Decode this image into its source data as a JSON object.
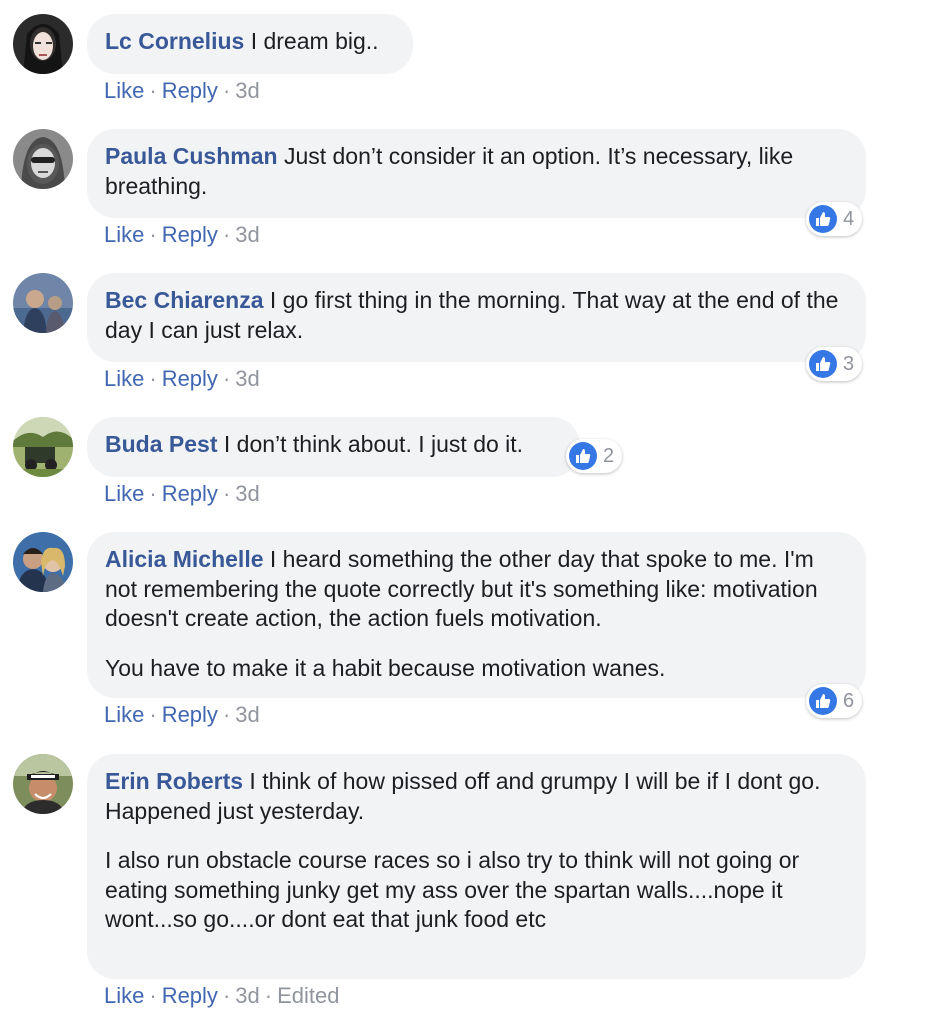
{
  "comments": [
    {
      "author": "Lc Cornelius",
      "paragraphs": [
        "I dream big.."
      ],
      "like": "Like",
      "reply": "Reply",
      "time": "3d",
      "edited": "",
      "reactions": ""
    },
    {
      "author": "Paula Cushman",
      "paragraphs": [
        "Just don’t consider it an option. It’s necessary, like breathing."
      ],
      "like": "Like",
      "reply": "Reply",
      "time": "3d",
      "edited": "",
      "reactions": "4"
    },
    {
      "author": "Bec Chiarenza",
      "paragraphs": [
        "I go first thing in the morning. That way at the end of the day I can just relax."
      ],
      "like": "Like",
      "reply": "Reply",
      "time": "3d",
      "edited": "",
      "reactions": "3"
    },
    {
      "author": "Buda Pest",
      "paragraphs": [
        "I don’t think about. I just do it."
      ],
      "like": "Like",
      "reply": "Reply",
      "time": "3d",
      "edited": "",
      "reactions": "2"
    },
    {
      "author": "Alicia Michelle",
      "paragraphs": [
        "I heard something the other day that spoke to me. I'm not remembering the quote correctly but it's something like: motivation doesn't create action, the action fuels motivation.",
        "You have to make it a habit because motivation wanes."
      ],
      "like": "Like",
      "reply": "Reply",
      "time": "3d",
      "edited": "",
      "reactions": "6"
    },
    {
      "author": "Erin Roberts",
      "paragraphs": [
        "I think of how pissed off and grumpy I will be if I dont go. Happened just yesterday.",
        "I also run obstacle course races so i also try to think will not going or eating something junky get my ass over the spartan walls....nope it wont...so go....or dont eat that junk food etc"
      ],
      "like": "Like",
      "reply": "Reply",
      "time": "3d",
      "edited": "Edited",
      "reactions": ""
    }
  ],
  "separator": "·",
  "colors": {
    "author": "#385898",
    "link": "#4267b2",
    "meta": "#90949c",
    "bubble": "#f2f3f5",
    "like_blue": "#3578e5"
  },
  "icons": {
    "reaction": "thumbs-up-icon"
  }
}
